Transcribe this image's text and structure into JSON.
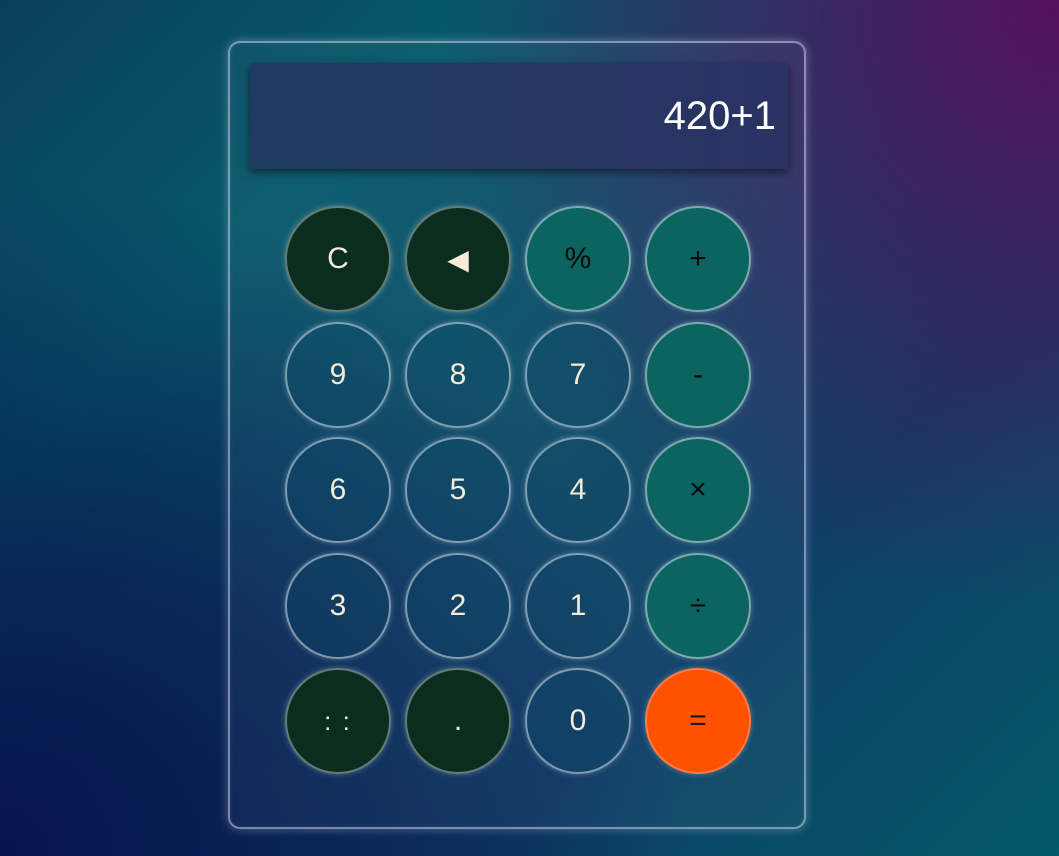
{
  "display": {
    "value": "420+1"
  },
  "colors": {
    "number_key": "#0c4664",
    "dark_key": "#0a2d1f",
    "operator_key": "#0c6461",
    "equals_key": "#ff5200",
    "key_text_light": "#f4ecd6",
    "display_bg": "#1f3b63"
  },
  "keys": [
    {
      "label": "C",
      "kind": "dark",
      "name": "clear-button"
    },
    {
      "label": "◀",
      "kind": "dark",
      "name": "backspace-button",
      "icon": "backspace-icon"
    },
    {
      "label": "%",
      "kind": "op",
      "name": "percent-button"
    },
    {
      "label": "+",
      "kind": "op",
      "name": "add-button"
    },
    {
      "label": "9",
      "kind": "num",
      "name": "digit-9-button"
    },
    {
      "label": "8",
      "kind": "num",
      "name": "digit-8-button"
    },
    {
      "label": "7",
      "kind": "num",
      "name": "digit-7-button"
    },
    {
      "label": "-",
      "kind": "op",
      "name": "subtract-button"
    },
    {
      "label": "6",
      "kind": "num",
      "name": "digit-6-button"
    },
    {
      "label": "5",
      "kind": "num",
      "name": "digit-5-button"
    },
    {
      "label": "4",
      "kind": "num",
      "name": "digit-4-button"
    },
    {
      "label": "×",
      "kind": "op",
      "name": "multiply-button"
    },
    {
      "label": "3",
      "kind": "num",
      "name": "digit-3-button"
    },
    {
      "label": "2",
      "kind": "num",
      "name": "digit-2-button"
    },
    {
      "label": "1",
      "kind": "num",
      "name": "digit-1-button"
    },
    {
      "label": "÷",
      "kind": "op",
      "name": "divide-button"
    },
    {
      "label": ": :",
      "kind": "dark",
      "name": "more-button"
    },
    {
      "label": ".",
      "kind": "dark",
      "name": "decimal-button"
    },
    {
      "label": "0",
      "kind": "num",
      "name": "digit-0-button"
    },
    {
      "label": "=",
      "kind": "equals",
      "name": "equals-button"
    }
  ]
}
